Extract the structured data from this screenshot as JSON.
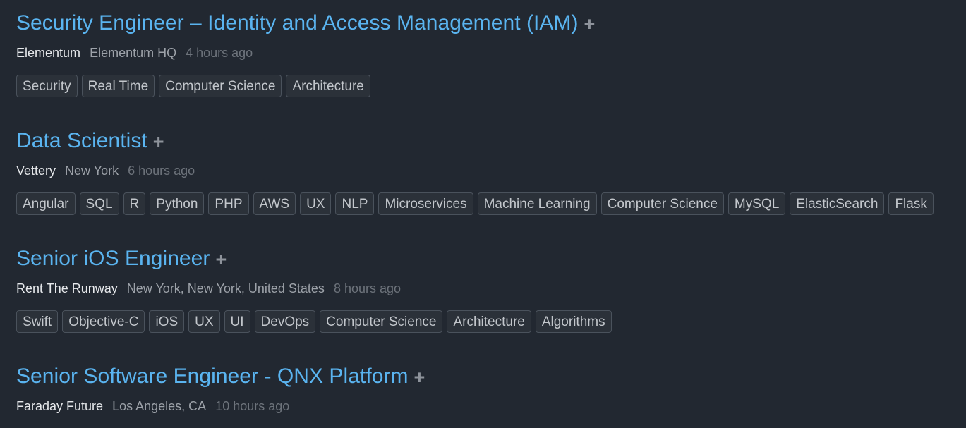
{
  "add_symbol": "+",
  "jobs": [
    {
      "title": "Security Engineer – Identity and Access Management (IAM)",
      "company": "Elementum",
      "location": "Elementum HQ",
      "posted": "4 hours ago",
      "tags": [
        "Security",
        "Real Time",
        "Computer Science",
        "Architecture"
      ]
    },
    {
      "title": "Data Scientist",
      "company": "Vettery",
      "location": "New York",
      "posted": "6 hours ago",
      "tags": [
        "Angular",
        "SQL",
        "R",
        "Python",
        "PHP",
        "AWS",
        "UX",
        "NLP",
        "Microservices",
        "Machine Learning",
        "Computer Science",
        "MySQL",
        "ElasticSearch",
        "Flask"
      ]
    },
    {
      "title": "Senior iOS Engineer",
      "company": "Rent The Runway",
      "location": "New York, New York, United States",
      "posted": "8 hours ago",
      "tags": [
        "Swift",
        "Objective-C",
        "iOS",
        "UX",
        "UI",
        "DevOps",
        "Computer Science",
        "Architecture",
        "Algorithms"
      ]
    },
    {
      "title": "Senior Software Engineer - QNX Platform",
      "company": "Faraday Future",
      "location": "Los Angeles, CA",
      "posted": "10 hours ago",
      "tags": []
    }
  ]
}
